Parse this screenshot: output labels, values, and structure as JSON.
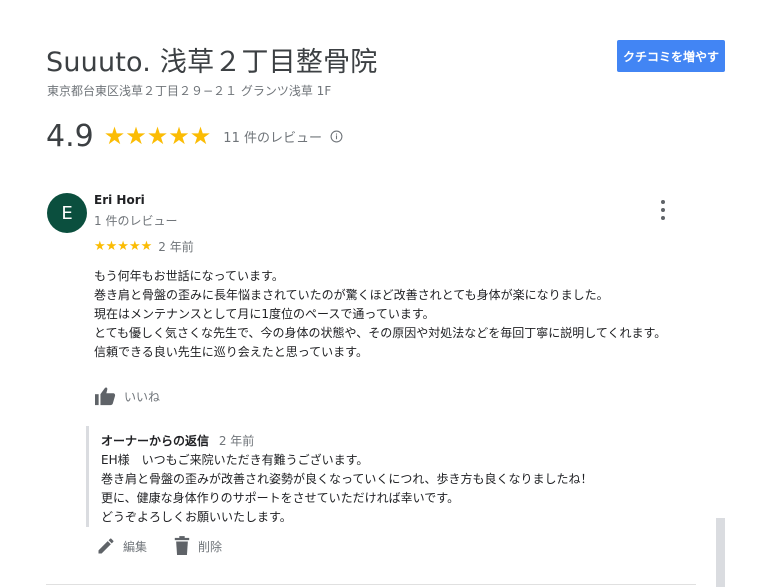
{
  "place": {
    "title": "Suuuto. 浅草２丁目整骨院",
    "address": "東京都台東区浅草２丁目２９−２１ グランツ浅草 1F",
    "add_reviews_button": "クチコミを増やす"
  },
  "summary": {
    "rating": "4.9",
    "stars": "★★★★★",
    "review_count": "11 件のレビュー"
  },
  "review": {
    "avatar_letter": "E",
    "author": "Eri Hori",
    "author_sub": "1 件のレビュー",
    "stars": "★★★★★",
    "date": "2 年前",
    "lines": [
      "もう何年もお世話になっています。",
      "巻き肩と骨盤の歪みに長年悩まされていたのが驚くほど改善されとても身体が楽になりました。",
      "現在はメンテナンスとして月に1度位のペースで通っています。",
      "とても優しく気さくな先生で、今の身体の状態や、その原因や対処法などを毎回丁寧に説明してくれます。",
      "信頼できる良い先生に巡り会えたと思っています。"
    ],
    "like_label": "いいね"
  },
  "owner_reply": {
    "title": "オーナーからの返信",
    "date": "2 年前",
    "lines": [
      "EH様　いつもご来院いただき有難うございます。",
      "巻き肩と骨盤の歪みが改善され姿勢が良くなっていくにつれ、歩き方も良くなりましたね！",
      "更に、健康な身体作りのサポートをさせていただければ幸いです。",
      "どうぞよろしくお願いいたします。"
    ],
    "edit_label": "編集",
    "delete_label": "削除"
  },
  "colors": {
    "accent": "#4285f4",
    "star": "#fbbc04",
    "avatar_bg": "#0b4f3e",
    "muted": "#70757a"
  },
  "icons": [
    "info-icon",
    "more-vert-icon",
    "thumb-up-icon",
    "pencil-icon",
    "trash-icon"
  ]
}
